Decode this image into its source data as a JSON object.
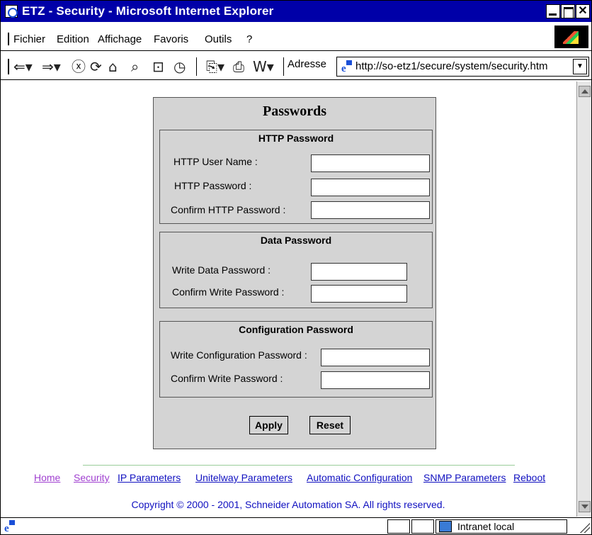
{
  "window": {
    "title": "ETZ - Security - Microsoft Internet Explorer"
  },
  "menu": {
    "items": [
      {
        "label": "Fichier"
      },
      {
        "label": "Edition"
      },
      {
        "label": "Affichage"
      },
      {
        "label": "Favoris"
      },
      {
        "label": "Outils"
      },
      {
        "label": "?"
      }
    ]
  },
  "toolbar": {
    "icons": [
      "back-icon",
      "forward-icon",
      "stop-icon",
      "refresh-icon",
      "home-icon",
      "search-icon",
      "favorites-icon",
      "history-icon",
      "mail-icon",
      "print-icon",
      "edit-icon"
    ],
    "address_label": "Adresse",
    "address_value": "http://so-etz1/secure/system/security.htm"
  },
  "form": {
    "title": "Passwords",
    "http": {
      "title": "HTTP Password",
      "user_label": "HTTP User Name :",
      "password_label": "HTTP Password :",
      "confirm_label": "Confirm HTTP Password :",
      "user_value": "",
      "password_value": "",
      "confirm_value": ""
    },
    "data": {
      "title": "Data Password",
      "write_label": "Write Data Password :",
      "confirm_label": "Confirm Write Password :",
      "write_value": "",
      "confirm_value": ""
    },
    "config": {
      "title": "Configuration Password",
      "write_label": "Write Configuration Password :",
      "confirm_label": "Confirm Write Password :",
      "write_value": "",
      "confirm_value": ""
    },
    "apply_label": "Apply",
    "reset_label": "Reset"
  },
  "footer": {
    "links": [
      {
        "label": "Home"
      },
      {
        "label": "Security"
      },
      {
        "label": "IP Parameters"
      },
      {
        "label": "Unitelway Parameters"
      },
      {
        "label": "Automatic Configuration"
      },
      {
        "label": "SNMP Parameters"
      },
      {
        "label": "Reboot"
      }
    ],
    "copyright": "Copyright © 2000 - 2001, Schneider Automation SA. All rights reserved."
  },
  "status": {
    "zone": "Intranet local"
  },
  "colors": {
    "titlebar": "#0000a8",
    "panel": "#d4d4d4",
    "link": "#1010c0",
    "visited_link": "#a040d0"
  }
}
